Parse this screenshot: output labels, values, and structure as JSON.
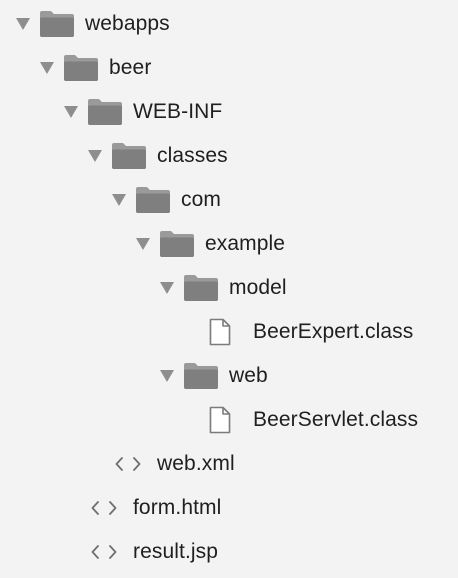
{
  "tree": {
    "items": [
      {
        "label": "webapps",
        "type": "folder",
        "expanded": true,
        "depth": 0
      },
      {
        "label": "beer",
        "type": "folder",
        "expanded": true,
        "depth": 1
      },
      {
        "label": "WEB-INF",
        "type": "folder",
        "expanded": true,
        "depth": 2
      },
      {
        "label": "classes",
        "type": "folder",
        "expanded": true,
        "depth": 3
      },
      {
        "label": "com",
        "type": "folder",
        "expanded": true,
        "depth": 4
      },
      {
        "label": "example",
        "type": "folder",
        "expanded": true,
        "depth": 5
      },
      {
        "label": "model",
        "type": "folder",
        "expanded": true,
        "depth": 6
      },
      {
        "label": "BeerExpert.class",
        "type": "file",
        "depth": 7
      },
      {
        "label": "web",
        "type": "folder",
        "expanded": true,
        "depth": 6
      },
      {
        "label": "BeerServlet.class",
        "type": "file",
        "depth": 7
      },
      {
        "label": "web.xml",
        "type": "code",
        "depth": 3
      },
      {
        "label": "form.html",
        "type": "code",
        "depth": 2
      },
      {
        "label": "result.jsp",
        "type": "code",
        "depth": 2
      }
    ]
  },
  "icons": {
    "folder": "folder-icon",
    "file": "file-icon",
    "code": "code-file-icon",
    "twisty": "disclosure-triangle-icon"
  },
  "colors": {
    "background": "#f3f3f3",
    "text": "#1f1f1f",
    "folder_back": "#9a9a9a",
    "folder_front": "#8a8a8a",
    "twisty": "#8e8e8e",
    "file_outline": "#7b7b7b"
  }
}
